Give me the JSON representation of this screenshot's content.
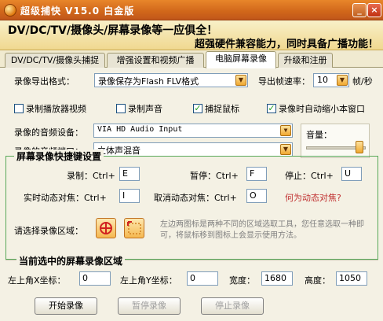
{
  "window": {
    "title": "超级捕快 V15.0 白金版"
  },
  "banner": {
    "line1": "DV/DC/TV/摄像头/屏幕录像等一应俱全！",
    "line2": "超强硬件兼容能力，同时具备广播功能！"
  },
  "tabs": [
    {
      "label": "DV/DC/TV/摄像头捕捉",
      "active": false
    },
    {
      "label": "增强设置和视频广播",
      "active": false
    },
    {
      "label": "电脑屏幕录像",
      "active": true
    },
    {
      "label": "升级和注册",
      "active": false
    }
  ],
  "export": {
    "format_label": "录像导出格式：",
    "format_value": "录像保存为Flash FLV格式",
    "fps_label": "导出帧速率：",
    "fps_value": "10",
    "fps_unit": "帧/秒"
  },
  "checks": [
    {
      "label": "录制播放器视频",
      "checked": false
    },
    {
      "label": "录制声音",
      "checked": false
    },
    {
      "label": "捕捉鼠标",
      "checked": true
    },
    {
      "label": "录像时自动缩小本窗口",
      "checked": true
    }
  ],
  "audio": {
    "device_label": "录像的音频设备：",
    "device_value": "VIA HD Audio Input",
    "port_label": "录像的音频端口：",
    "port_value": "立体声混音",
    "volume_label": "音量：",
    "volume_level": 0.9
  },
  "hotkeys": {
    "title": "屏幕录像快捷键设置",
    "record_label": "录制：Ctrl+",
    "record_key": "E",
    "pause_label": "暂停：Ctrl+",
    "pause_key": "F",
    "stop_label": "停止：Ctrl+",
    "stop_key": "U",
    "track_label": "实时动态对焦：Ctrl+",
    "track_key": "I",
    "cancel_label": "取消动态对焦：Ctrl+",
    "cancel_key": "O",
    "what_link": "何为动态对焦?"
  },
  "region_select": {
    "label": "请选择录像区域：",
    "hint": "左边两图标是两种不同的区域选取工具，您任意选取一种即可，将鼠标移到图标上会显示使用方法。"
  },
  "current_region": {
    "title": "当前选中的屏幕录像区域",
    "x_label": "左上角X坐标：",
    "x_value": "0",
    "y_label": "左上角Y坐标：",
    "y_value": "0",
    "width_label": "宽度：",
    "width_value": "1680",
    "height_label": "高度：",
    "height_value": "1050"
  },
  "actions": {
    "start": "开始录像",
    "pause": "暂停录像",
    "stop": "停止录像"
  }
}
